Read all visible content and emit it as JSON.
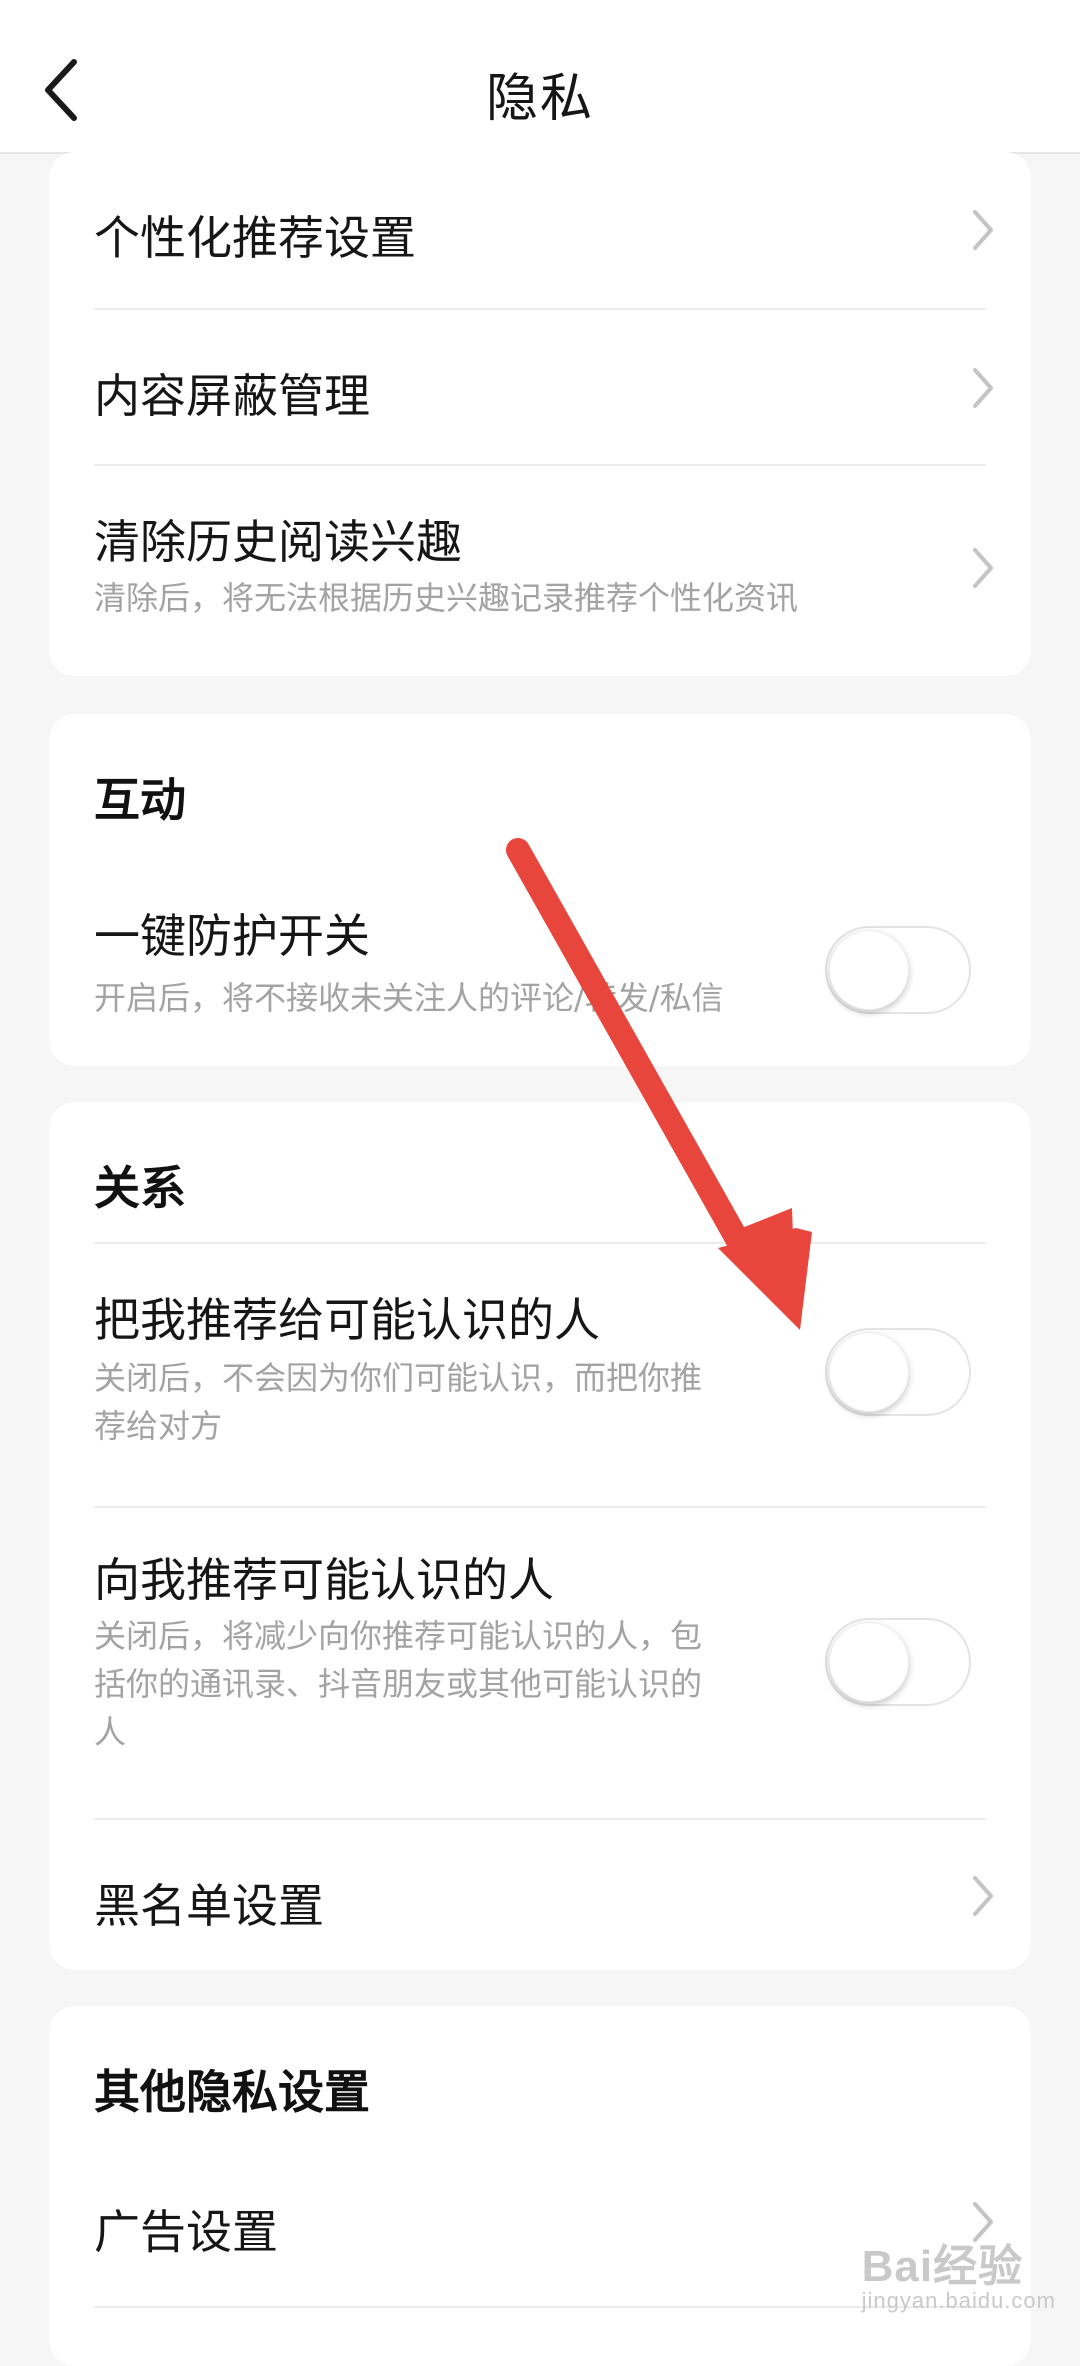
{
  "header": {
    "title": "隐私",
    "back_icon": "chevron-left-icon"
  },
  "colors": {
    "background": "#f6f6f6",
    "card": "#ffffff",
    "annotation_arrow": "#e8453c",
    "secondary_text": "#a3a3a3"
  },
  "recommend_section": {
    "items": [
      {
        "title": "个性化推荐设置"
      },
      {
        "title": "内容屏蔽管理"
      },
      {
        "title": "清除历史阅读兴趣",
        "desc": "清除后，将无法根据历史兴趣记录推荐个性化资讯"
      }
    ]
  },
  "interaction_section": {
    "title": "互动",
    "items": [
      {
        "title": "一键防护开关",
        "desc": "开启后，将不接收未关注人的评论/转发/私信",
        "enabled": false
      }
    ]
  },
  "relation_section": {
    "title": "关系",
    "items": [
      {
        "title": "把我推荐给可能认识的人",
        "desc_line1": "关闭后，不会因为你们可能认识，而把你推",
        "desc_line2": "荐给对方",
        "enabled": false
      },
      {
        "title": "向我推荐可能认识的人",
        "desc_line1": "关闭后，将减少向你推荐可能认识的人，包",
        "desc_line2": "括你的通讯录、抖音朋友或其他可能认识的",
        "desc_line3": "人",
        "enabled": false
      },
      {
        "title": "黑名单设置"
      }
    ]
  },
  "other_section": {
    "title": "其他隐私设置",
    "items": [
      {
        "title": "广告设置"
      }
    ]
  },
  "watermark": {
    "text": "Bai经验",
    "sub": "jingyan.baidu.com"
  }
}
